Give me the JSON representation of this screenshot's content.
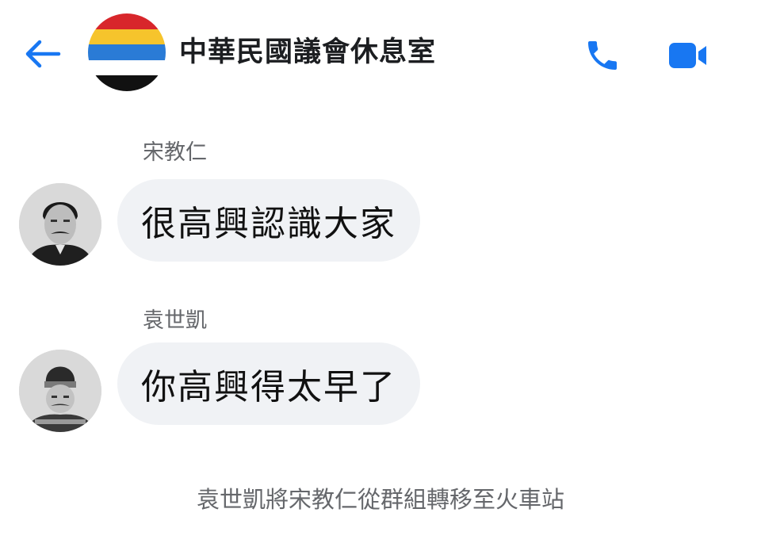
{
  "header": {
    "back_icon": "arrow-left-icon",
    "group_avatar": {
      "icon": "five-color-flag",
      "stripes": [
        "#d8262b",
        "#f6c42c",
        "#2a7bd6",
        "#ffffff",
        "#111111"
      ]
    },
    "title": "中華民國議會休息室",
    "call_icon": "phone-icon",
    "video_icon": "video-camera-icon",
    "accent_color": "#1877f2"
  },
  "messages": [
    {
      "sender": "宋教仁",
      "avatar_icon": "portrait-photo",
      "text": "很高興認識大家"
    },
    {
      "sender": "袁世凱",
      "avatar_icon": "portrait-photo",
      "text": "你高興得太早了"
    }
  ],
  "system_note": "袁世凱將宋教仁從群組轉移至火車站"
}
